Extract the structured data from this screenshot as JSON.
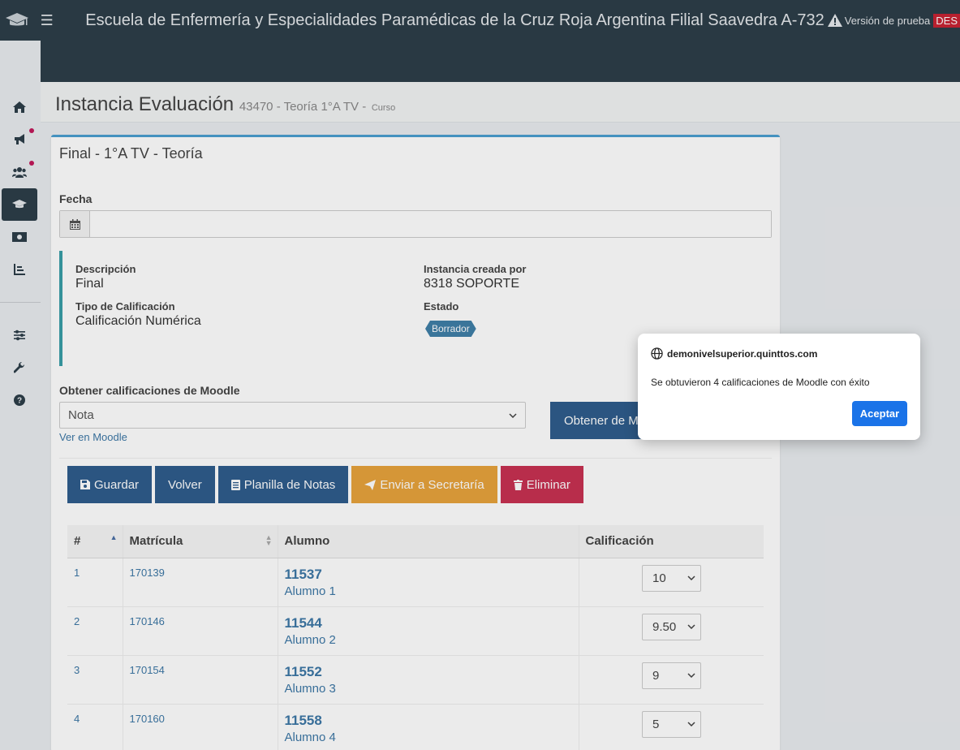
{
  "topbar": {
    "title": "Escuela de Enfermería y Especialidades Paramédicas de la Cruz Roja Argentina Filial Saavedra A-732",
    "trial_label": "Versión de prueba",
    "env_badge": "DES"
  },
  "page": {
    "title": "Instancia Evaluación",
    "subtitle": "43470 - Teoría 1°A TV -",
    "subtitle_small": "Curso"
  },
  "card": {
    "title": "Final - 1°A TV - Teoría",
    "date_label": "Fecha",
    "date_value": "",
    "info": {
      "descripcion_label": "Descripción",
      "descripcion_value": "Final",
      "tipo_label": "Tipo de Calificación",
      "tipo_value": "Calificación Numérica",
      "creada_label": "Instancia creada por",
      "creada_value": "8318 SOPORTE",
      "estado_label": "Estado",
      "estado_value": "Borrador"
    },
    "moodle": {
      "label": "Obtener calificaciones de Moodle",
      "selected": "Nota",
      "link": "Ver en Moodle",
      "button": "Obtener de M"
    },
    "buttons": {
      "guardar": "Guardar",
      "volver": "Volver",
      "planilla": "Planilla de Notas",
      "enviar": "Enviar a Secretaría",
      "eliminar": "Eliminar"
    },
    "table": {
      "headers": [
        "#",
        "Matrícula",
        "Alumno",
        "Calificación"
      ],
      "rows": [
        {
          "n": "1",
          "matricula": "170139",
          "id": "11537",
          "name": "Alumno 1",
          "grade": "10"
        },
        {
          "n": "2",
          "matricula": "170146",
          "id": "11544",
          "name": "Alumno 2",
          "grade": "9.50"
        },
        {
          "n": "3",
          "matricula": "170154",
          "id": "11552",
          "name": "Alumno 3",
          "grade": "9"
        },
        {
          "n": "4",
          "matricula": "170160",
          "id": "11558",
          "name": "Alumno 4",
          "grade": "5"
        }
      ]
    }
  },
  "dialog": {
    "origin": "demonivelsuperior.quinttos.com",
    "message": "Se obtuvieron 4 calificaciones de Moodle con éxito",
    "accept": "Aceptar"
  },
  "colors": {
    "topbar": "#2d3e49",
    "primary": "#2f5d8c",
    "warning": "#e8a33c",
    "danger": "#c83152",
    "dialog_button": "#1a73e8"
  }
}
